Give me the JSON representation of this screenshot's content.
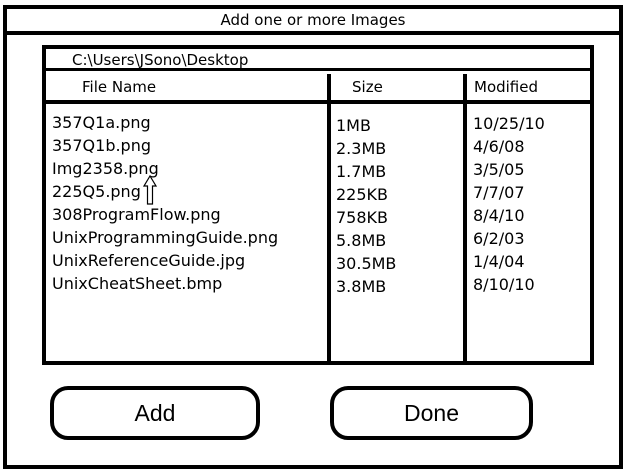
{
  "dialog": {
    "title": "Add one or more Images",
    "path": "C:\\Users\\JSono\\Desktop",
    "columns": {
      "name": "File Name",
      "size": "Size",
      "modified": "Modified"
    },
    "files": [
      {
        "name": "357Q1a.png",
        "size": "1MB",
        "modified": "10/25/10"
      },
      {
        "name": "357Q1b.png",
        "size": "2.3MB",
        "modified": "4/6/08"
      },
      {
        "name": "Img2358.png",
        "size": "1.7MB",
        "modified": "3/5/05"
      },
      {
        "name": "225Q5.png",
        "size": "225KB",
        "modified": "7/7/07"
      },
      {
        "name": "308ProgramFlow.png",
        "size": "758KB",
        "modified": "8/4/10"
      },
      {
        "name": "UnixProgrammingGuide.png",
        "size": "5.8MB",
        "modified": "6/2/03"
      },
      {
        "name": "UnixReferenceGuide.jpg",
        "size": "30.5MB",
        "modified": "1/4/04"
      },
      {
        "name": "UnixCheatSheet.bmp",
        "size": "3.8MB",
        "modified": "8/10/10"
      }
    ],
    "buttons": {
      "add": "Add",
      "done": "Done"
    }
  },
  "icons": {
    "cursor": "arrow-cursor-icon"
  }
}
